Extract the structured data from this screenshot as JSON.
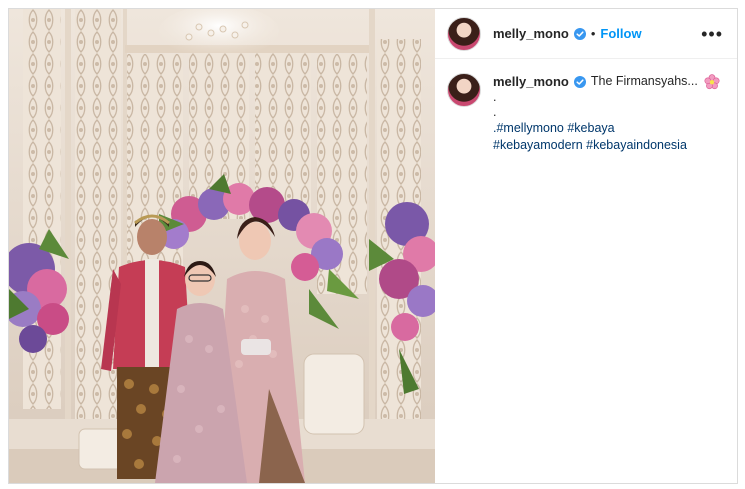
{
  "post": {
    "author": {
      "username": "melly_mono",
      "verified": true,
      "avatar_icon": "profile-photo"
    },
    "header": {
      "separator": "•",
      "follow_label": "Follow",
      "more_label": "•••"
    },
    "caption": {
      "username": "melly_mono",
      "text": "The Firmansyahs...",
      "emoji": "pink-flower-emoji",
      "dots": [
        ".",
        "."
      ],
      "tag_prefix": ".",
      "tags_line1": [
        "#mellymono",
        "#kebaya"
      ],
      "tags_line2": [
        "#kebayamodern",
        "#kebayaindonesia"
      ]
    },
    "colors": {
      "link_blue": "#0095f6",
      "hashtag": "#00376b",
      "verified": "#3897f0",
      "border": "#dbdbdb"
    }
  }
}
